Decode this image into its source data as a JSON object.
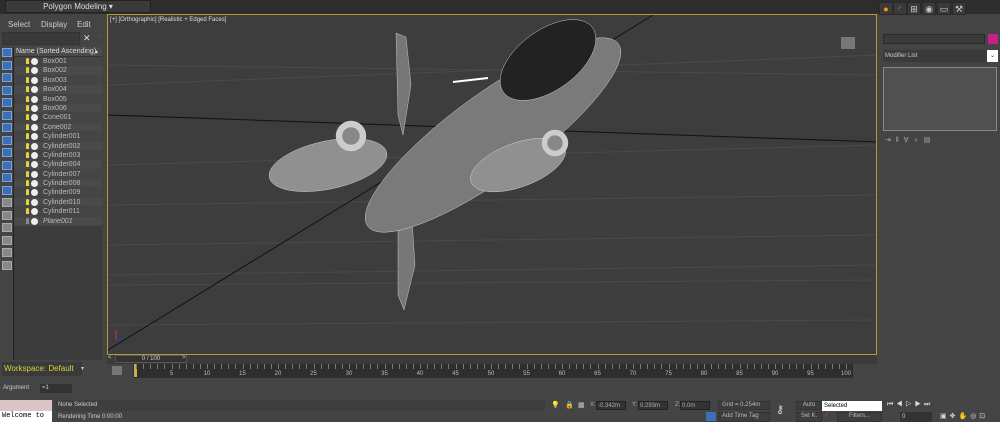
{
  "ribbon": {
    "title": "Polygon Modeling",
    "arrow": "▾"
  },
  "scene_explorer": {
    "menu": [
      "Select",
      "Display",
      "Edit"
    ],
    "close": "✕",
    "expand": "»",
    "column_header": "Name (Sorted Ascending)",
    "sort_arrow": "▲",
    "items": [
      {
        "name": "Box001",
        "on": true
      },
      {
        "name": "Box002",
        "on": true
      },
      {
        "name": "Box003",
        "on": true
      },
      {
        "name": "Box004",
        "on": true
      },
      {
        "name": "Box005",
        "on": true
      },
      {
        "name": "Box006",
        "on": true
      },
      {
        "name": "Cone001",
        "on": true
      },
      {
        "name": "Cone002",
        "on": true
      },
      {
        "name": "Cylinder001",
        "on": true
      },
      {
        "name": "Cylinder002",
        "on": true
      },
      {
        "name": "Cylinder003",
        "on": true
      },
      {
        "name": "Cylinder004",
        "on": true
      },
      {
        "name": "Cylinder007",
        "on": true
      },
      {
        "name": "Cylinder008",
        "on": true
      },
      {
        "name": "Cylinder009",
        "on": true
      },
      {
        "name": "Cylinder010",
        "on": true
      },
      {
        "name": "Cylinder011",
        "on": true
      },
      {
        "name": "Plane001",
        "on": false
      }
    ]
  },
  "viewport": {
    "label": "[+] [Orthographic] [Realistic + Edged Faces]"
  },
  "timeline": {
    "slider": "0 / 100",
    "prev": "<",
    "next": ">",
    "ticks": [
      5,
      10,
      15,
      20,
      25,
      30,
      35,
      40,
      45,
      50,
      55,
      60,
      65,
      70,
      75,
      80,
      85,
      90,
      95,
      100
    ],
    "start": 0,
    "end": 100,
    "current": 0
  },
  "workspace": {
    "label": "Workspace: Default"
  },
  "argument": {
    "label": "Argument",
    "value": "=1"
  },
  "maxscript": {
    "output": "Welcome to"
  },
  "status": {
    "selection": "None Selected",
    "render_time": "Rendering Time  0:00:00",
    "x_label": "X:",
    "x": "-0.342m",
    "y_label": "Y:",
    "y": "0.293m",
    "z_label": "Z:",
    "z": "0.0m",
    "grid": "Grid = 0.254m",
    "add_time_tag": "Add Time Tag",
    "auto": "Auto",
    "set_key": "Set K.",
    "key_mode": "Selected",
    "filters": "Filters...",
    "frame": "0"
  },
  "command_panel": {
    "modifier_list": "Modifier List",
    "color": "#c8208a"
  },
  "colors": {
    "accent": "#d7d23a",
    "viewport_border": "#b49a3a"
  }
}
